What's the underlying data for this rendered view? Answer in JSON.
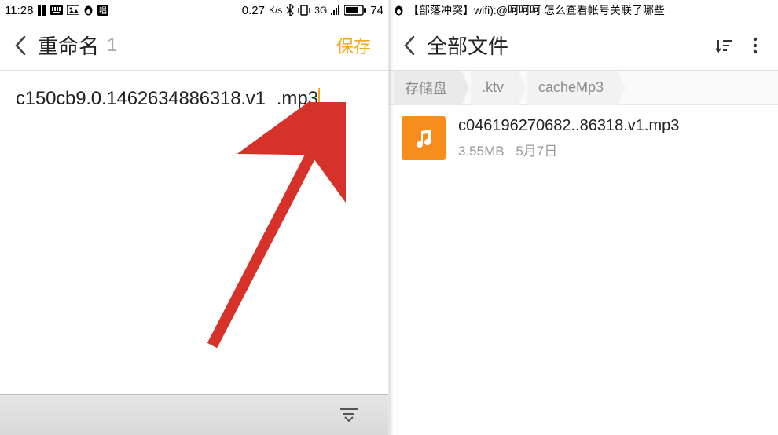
{
  "left": {
    "status": {
      "time": "11:28",
      "speed": "0.27",
      "speed_unit": "K/s",
      "net": "3G",
      "battery": "74"
    },
    "header": {
      "title": "重命名",
      "count": "1",
      "save": "保存"
    },
    "rename": {
      "base": "c150cb9.0.1462634886318.v1",
      "ext": ".mp3"
    }
  },
  "right": {
    "status": {
      "notif": "【部落冲突】wifi):@呵呵呵 怎么查看帐号关联了哪些"
    },
    "header": {
      "title": "全部文件"
    },
    "breadcrumb": [
      "存储盘",
      ".ktv",
      "cacheMp3"
    ],
    "file": {
      "name": "c046196270682..86318.v1.mp3",
      "size": "3.55MB",
      "date": "5月7日"
    }
  }
}
